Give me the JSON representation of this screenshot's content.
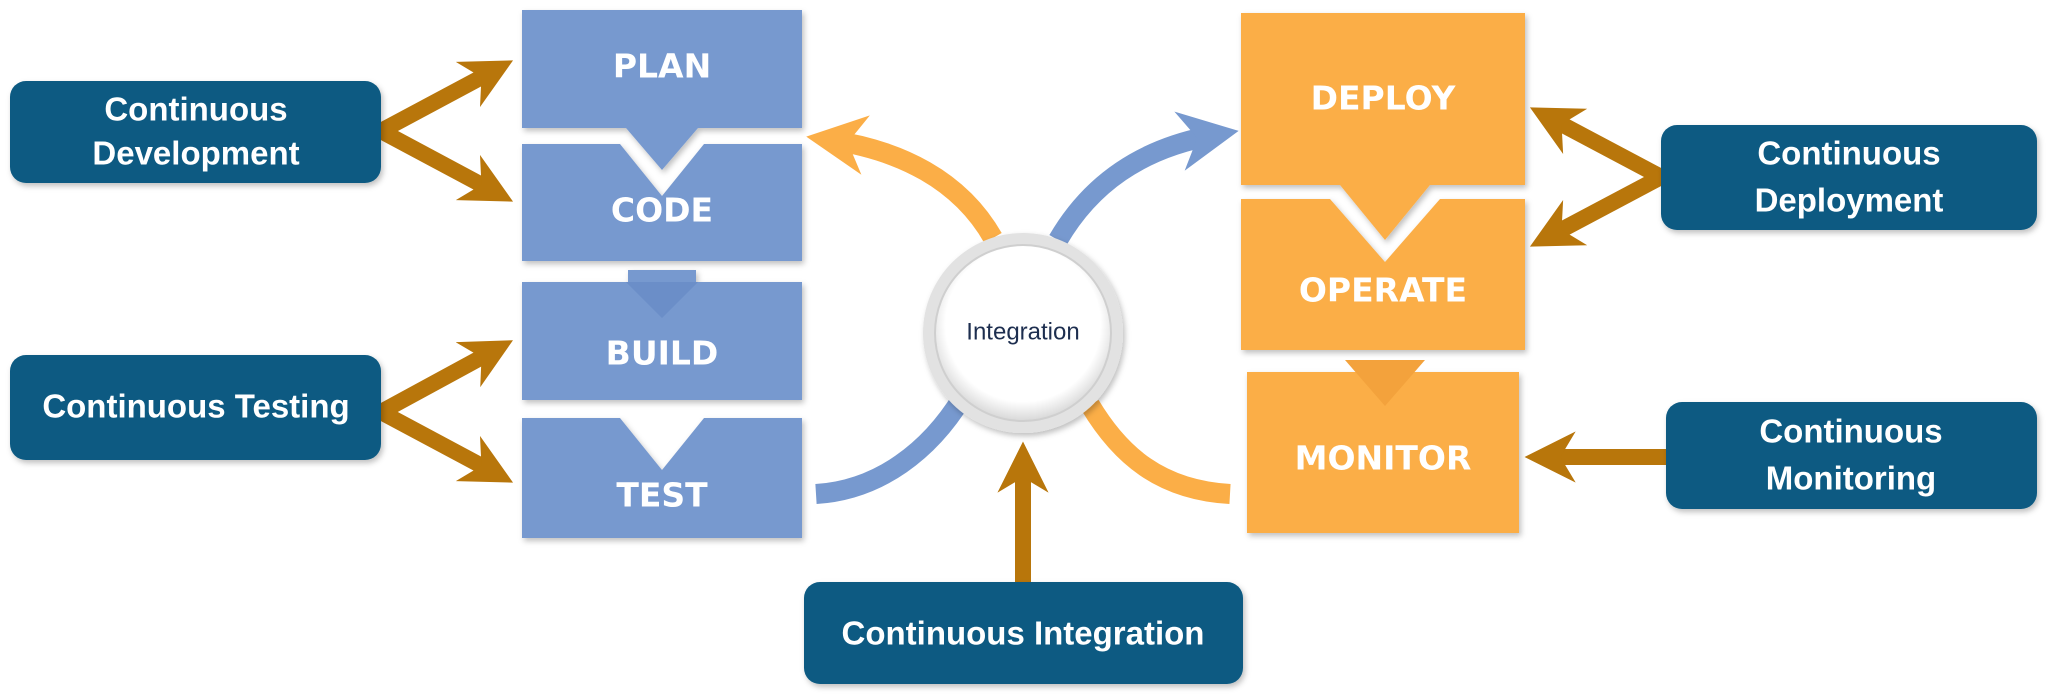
{
  "colors": {
    "blue_stage": "#7799cf",
    "orange_stage": "#fbae47",
    "label_box": "#0a5a82",
    "arrow": "#b8760b",
    "hub_text": "#1d2e4f"
  },
  "stages": {
    "plan": "PLAN",
    "code": "CODE",
    "build": "BUILD",
    "test": "TEST",
    "deploy": "DEPLOY",
    "operate": "OPERATE",
    "monitor": "MONITOR"
  },
  "hub": "Integration",
  "labels": {
    "development": [
      "Continuous",
      "Development"
    ],
    "testing": "Continuous Testing",
    "integration": "Continuous Integration",
    "deployment": [
      "Continuous",
      "Deployment"
    ],
    "monitoring": [
      "Continuous",
      "Monitoring"
    ]
  }
}
